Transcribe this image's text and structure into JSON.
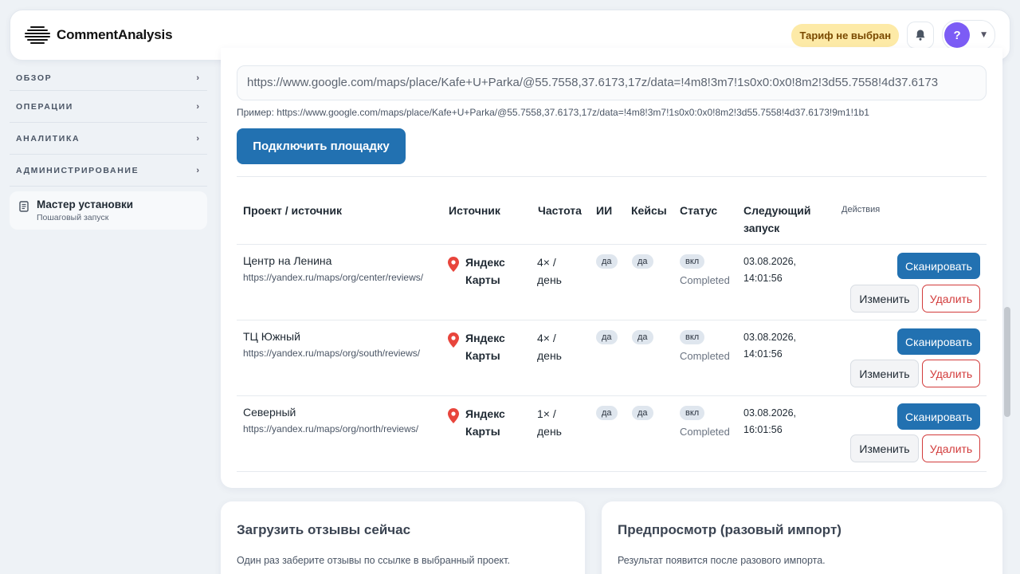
{
  "header": {
    "logo_text": "CommentAnalysis",
    "tariff_badge": "Тариф не выбран",
    "avatar_letter": "?"
  },
  "sidebar": {
    "items": [
      {
        "label": "ОБЗОР"
      },
      {
        "label": "ОПЕРАЦИИ"
      },
      {
        "label": "АНАЛИТИКА"
      },
      {
        "label": "АДМИНИСТРИРОВАНИЕ"
      }
    ],
    "chevron": "›",
    "wizard": {
      "title": "Мастер установки",
      "subtitle": "Пошаговый запуск"
    }
  },
  "connect": {
    "url_value": "https://www.google.com/maps/place/Kafe+U+Parka/@55.7558,37.6173,17z/data=!4m8!3m7!1s0x0:0x0!8m2!3d55.7558!4d37.6173",
    "example": "Пример: https://www.google.com/maps/place/Kafe+U+Parka/@55.7558,37.6173,17z/data=!4m8!3m7!1s0x0:0x0!8m2!3d55.7558!4d37.6173!9m1!1b1",
    "button_label": "Подключить площадку"
  },
  "table": {
    "headers": {
      "project": "Проект / источник",
      "source": "Источник",
      "frequency": "Частота",
      "ai": "ИИ",
      "cases": "Кейсы",
      "status": "Статус",
      "next_run_1": "Следующий",
      "next_run_2": "запуск",
      "actions": "Действия"
    },
    "rows": [
      {
        "name": "Центр на Ленина",
        "url": "https://yandex.ru/maps/org/center/reviews/",
        "source_1": "Яндекс",
        "source_2": "Карты",
        "freq_1": "4× /",
        "freq_2": "день",
        "ai": "да",
        "cases": "да",
        "status": "вкл",
        "status_sub": "Completed",
        "next_1": "03.08.2026,",
        "next_2": "14:01:56"
      },
      {
        "name": "ТЦ Южный",
        "url": "https://yandex.ru/maps/org/south/reviews/",
        "source_1": "Яндекс",
        "source_2": "Карты",
        "freq_1": "4× /",
        "freq_2": "день",
        "ai": "да",
        "cases": "да",
        "status": "вкл",
        "status_sub": "Completed",
        "next_1": "03.08.2026,",
        "next_2": "14:01:56"
      },
      {
        "name": "Северный",
        "url": "https://yandex.ru/maps/org/north/reviews/",
        "source_1": "Яндекс",
        "source_2": "Карты",
        "freq_1": "1× /",
        "freq_2": "день",
        "ai": "да",
        "cases": "да",
        "status": "вкл",
        "status_sub": "Completed",
        "next_1": "03.08.2026,",
        "next_2": "16:01:56"
      }
    ],
    "actions": {
      "scan": "Сканировать",
      "edit": "Изменить",
      "delete": "Удалить"
    }
  },
  "load_now": {
    "title": "Загрузить отзывы сейчас",
    "text": "Один раз заберите отзывы по ссылке в выбранный проект."
  },
  "preview": {
    "title": "Предпросмотр (разовый импорт)",
    "text": "Результат появится после разового импорта."
  },
  "colors": {
    "primary": "#2271b1",
    "danger": "#d23b3b",
    "badge": "#fdeaa7",
    "avatar": "#7c5cf5",
    "pin": "#e8453c"
  }
}
